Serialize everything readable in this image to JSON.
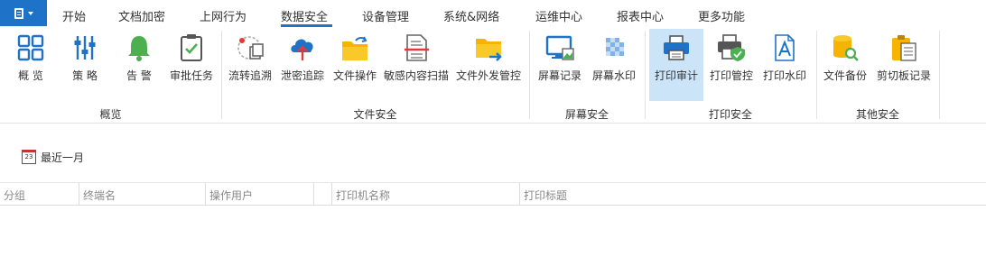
{
  "menu": {
    "tabs": [
      {
        "label": "开始"
      },
      {
        "label": "文档加密"
      },
      {
        "label": "上网行为"
      },
      {
        "label": "数据安全"
      },
      {
        "label": "设备管理"
      },
      {
        "label": "系统&网络"
      },
      {
        "label": "运维中心"
      },
      {
        "label": "报表中心"
      },
      {
        "label": "更多功能"
      }
    ],
    "active_tab": "数据安全"
  },
  "ribbon": {
    "groups": [
      {
        "label": "概览",
        "buttons": [
          {
            "label": "概 览",
            "icon": "grid-overview-icon"
          },
          {
            "label": "策 略",
            "icon": "sliders-policy-icon"
          },
          {
            "label": "告 警",
            "icon": "bell-alert-icon"
          },
          {
            "label": "审批任务",
            "icon": "clipboard-check-icon"
          }
        ]
      },
      {
        "label": "文件安全",
        "buttons": [
          {
            "label": "流转追溯",
            "icon": "flow-trace-icon"
          },
          {
            "label": "泄密追踪",
            "icon": "cloud-upload-icon"
          },
          {
            "label": "文件操作",
            "icon": "folder-sync-icon"
          },
          {
            "label": "敏感内容扫描",
            "icon": "document-scan-icon"
          },
          {
            "label": "文件外发管控",
            "icon": "folder-send-icon"
          }
        ]
      },
      {
        "label": "屏幕安全",
        "buttons": [
          {
            "label": "屏幕记录",
            "icon": "monitor-icon"
          },
          {
            "label": "屏幕水印",
            "icon": "watermark-icon"
          }
        ]
      },
      {
        "label": "打印安全",
        "buttons": [
          {
            "label": "打印审计",
            "icon": "printer-icon",
            "selected": true
          },
          {
            "label": "打印管控",
            "icon": "printer-shield-icon"
          },
          {
            "label": "打印水印",
            "icon": "text-document-icon"
          }
        ]
      },
      {
        "label": "其他安全",
        "buttons": [
          {
            "label": "文件备份",
            "icon": "database-search-icon"
          },
          {
            "label": "剪切板记录",
            "icon": "clipboard-note-icon"
          }
        ]
      }
    ]
  },
  "filter": {
    "calendar_day": "23",
    "range_label": "最近一月"
  },
  "table": {
    "columns": [
      "分组",
      "终端名",
      "操作用户",
      "打印机名称",
      "打印标题"
    ],
    "rows": []
  },
  "colors": {
    "accent": "#1e72c8",
    "selected_bg": "#cce4f7"
  }
}
